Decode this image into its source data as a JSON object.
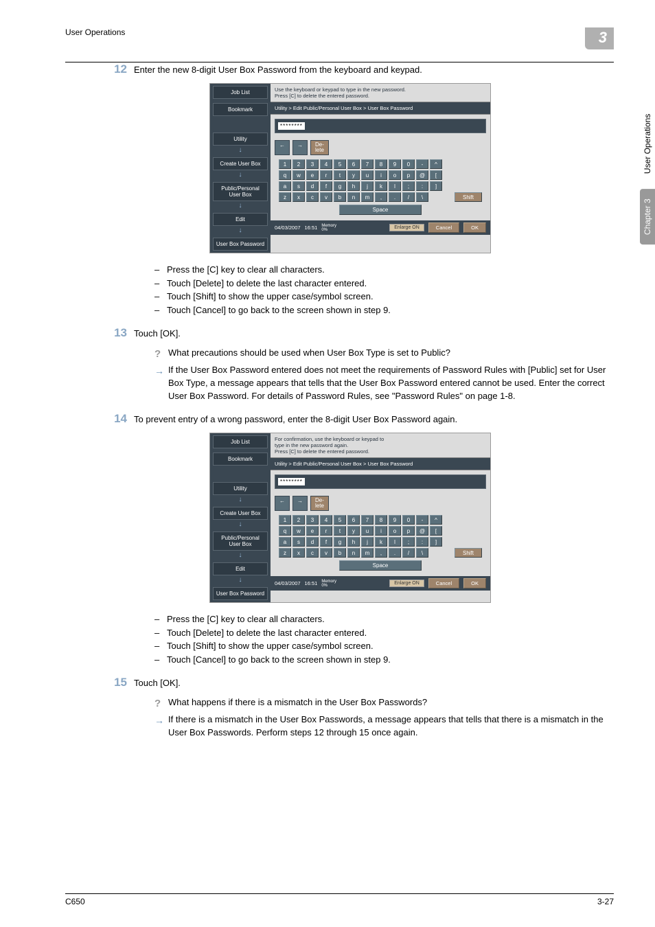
{
  "header": {
    "section": "User Operations",
    "chapter_num": "3"
  },
  "side": {
    "chapter": "Chapter 3",
    "section": "User Operations"
  },
  "steps": {
    "s12": {
      "num": "12",
      "text": "Enter the new 8-digit User Box Password from the keyboard and keypad."
    },
    "s13": {
      "num": "13",
      "text": "Touch [OK]."
    },
    "s14": {
      "num": "14",
      "text": "To prevent entry of a wrong password, enter the 8-digit User Box Password again."
    },
    "s15": {
      "num": "15",
      "text": "Touch [OK]."
    }
  },
  "bullets1": {
    "b0": "Press the [C] key to clear all characters.",
    "b1": "Touch [Delete] to delete the last character entered.",
    "b2": "Touch [Shift] to show the upper case/symbol screen.",
    "b3": "Touch [Cancel] to go back to the screen shown in step 9."
  },
  "qa1": {
    "q": "What precautions should be used when User Box Type is set to Public?",
    "a": "If the User Box Password entered does not meet the requirements of Password Rules with [Public] set for User Box Type, a message appears that tells that the User Box Password entered cannot be used. Enter the correct User Box Password. For details of Password Rules, see \"Password Rules\" on page 1-8."
  },
  "bullets2": {
    "b0": "Press the [C] key to clear all characters.",
    "b1": "Touch [Delete] to delete the last character entered.",
    "b2": "Touch [Shift] to show the upper case/symbol screen.",
    "b3": "Touch [Cancel] to go back to the screen shown in step 9."
  },
  "qa2": {
    "q": "What happens if there is a mismatch in the User Box Passwords?",
    "a": "If there is a mismatch in the User Box Passwords, a message appears that tells that there is a mismatch in the User Box Passwords. Perform steps 12 through 15 once again."
  },
  "screenshot": {
    "left": {
      "job_list": "Job List",
      "bookmark": "Bookmark",
      "utility": "Utility",
      "create": "Create User Box",
      "public": "Public/Personal User Box",
      "edit": "Edit",
      "ubpw": "User Box Password"
    },
    "msg1": "Use the keyboard or keypad to type in the new password.\nPress [C] to delete the entered password.",
    "msg2": "For confirmation, use the keyboard or keypad to\ntype in the new password again.\nPress [C] to delete the entered password.",
    "breadcrumb": "Utility > Edit Public/Personal User Box > User Box Password",
    "input": "********",
    "delete": "De-\nlete",
    "row1": [
      "1",
      "2",
      "3",
      "4",
      "5",
      "6",
      "7",
      "8",
      "9",
      "0",
      "-",
      "^"
    ],
    "row2": [
      "q",
      "w",
      "e",
      "r",
      "t",
      "y",
      "u",
      "i",
      "o",
      "p",
      "@",
      "["
    ],
    "row3": [
      "a",
      "s",
      "d",
      "f",
      "g",
      "h",
      "j",
      "k",
      "l",
      ";",
      ":",
      "]"
    ],
    "row4": [
      "z",
      "x",
      "c",
      "v",
      "b",
      "n",
      "m",
      ",",
      ".",
      "/",
      "\\"
    ],
    "shift": "Shift",
    "space": "Space",
    "footer": {
      "date": "04/03/2007",
      "time": "16:51",
      "memory": "Memory",
      "pct": "0%",
      "enlarge": "Enlarge ON",
      "cancel": "Cancel",
      "ok": "OK"
    }
  },
  "footer": {
    "left": "C650",
    "right": "3-27"
  }
}
